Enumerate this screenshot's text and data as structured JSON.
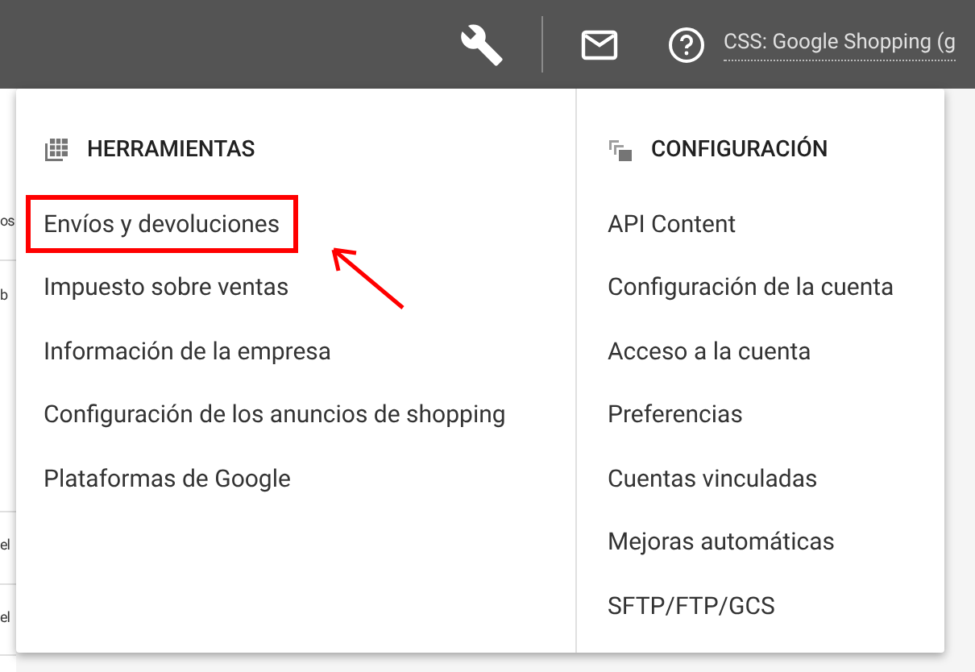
{
  "header": {
    "account": "CSS: Google Shopping (g"
  },
  "background_fragments": [
    "os",
    "b",
    "el",
    "el"
  ],
  "menu": {
    "columns": [
      {
        "kind": "tools",
        "heading": "HERRAMIENTAS",
        "items": [
          {
            "label": "Envíos y devoluciones",
            "highlighted": true
          },
          {
            "label": "Impuesto sobre ventas",
            "highlighted": false
          },
          {
            "label": "Información de la empresa",
            "highlighted": false
          },
          {
            "label": "Configuración de los anuncios de shopping",
            "highlighted": false
          },
          {
            "label": "Plataformas de Google",
            "highlighted": false
          }
        ]
      },
      {
        "kind": "settings",
        "heading": "CONFIGURACIÓN",
        "items": [
          {
            "label": "API Content",
            "highlighted": false
          },
          {
            "label": "Configuración de la cuenta",
            "highlighted": false
          },
          {
            "label": "Acceso a la cuenta",
            "highlighted": false
          },
          {
            "label": "Preferencias",
            "highlighted": false
          },
          {
            "label": "Cuentas vinculadas",
            "highlighted": false
          },
          {
            "label": "Mejoras automáticas",
            "highlighted": false
          },
          {
            "label": "SFTP/FTP/GCS",
            "highlighted": false
          }
        ]
      }
    ]
  }
}
